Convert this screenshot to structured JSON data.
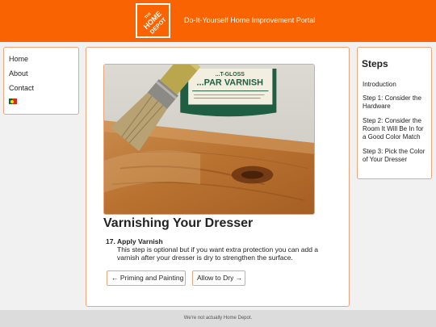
{
  "header": {
    "logo_text": "THE HOME DEPOT",
    "title": "Do-It-Yourself Home Improvement Portal"
  },
  "left_nav": {
    "items": [
      {
        "label": "Home"
      },
      {
        "label": "About"
      },
      {
        "label": "Contact"
      }
    ],
    "language_flag": "portugal-flag-icon"
  },
  "article": {
    "image_label_line1": "...T-GLOSS",
    "image_label_line2": "...PAR VARNISH",
    "title": "Varnishing Your Dresser",
    "step": {
      "number": "17.",
      "heading": "Apply Varnish",
      "text": "This step is optional but if you want extra protection you can add a varnish after your dresser is dry to strengthen the surface."
    },
    "prev_button": "← Priming and Painting",
    "next_button": "Allow to Dry →"
  },
  "steps_panel": {
    "heading": "Steps",
    "links": [
      {
        "label": "Introduction"
      },
      {
        "label": "Step 1: Consider the Hardware"
      },
      {
        "label": "Step 2: Consider the Room It Will Be In for a Good Color Match"
      },
      {
        "label": "Step 3: Pick the Color of Your Dresser"
      }
    ]
  },
  "footer": {
    "text": "We're not actually Home Depot."
  },
  "colors": {
    "brand_orange": "#f96302",
    "border_orange": "#f0a27a",
    "footer_gray": "#dcdcdc"
  }
}
